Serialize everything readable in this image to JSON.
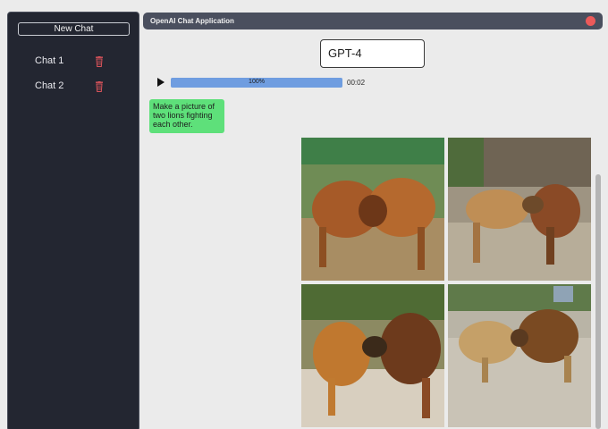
{
  "window": {
    "title": "OpenAI Chat Application"
  },
  "sidebar": {
    "new_chat_label": "New Chat",
    "chats": [
      {
        "label": "Chat 1"
      },
      {
        "label": "Chat 2"
      }
    ]
  },
  "model": {
    "selected": "GPT-4"
  },
  "audio": {
    "progress_label": "100%",
    "progress_fraction": 1.0,
    "elapsed": "00:02"
  },
  "message": {
    "text": "Make a picture of two lions fighting each other."
  },
  "images": [
    {
      "icon": "generated-image",
      "description": "lions-fighting-1"
    },
    {
      "icon": "generated-image",
      "description": "lions-fighting-2"
    },
    {
      "icon": "generated-image",
      "description": "lions-fighting-3"
    },
    {
      "icon": "generated-image",
      "description": "lions-fighting-4"
    }
  ],
  "colors": {
    "sidebar_bg": "#232631",
    "titlebar_bg": "#4a4f5e",
    "close_red": "#ec5a5a",
    "bubble_green": "#5ee07a",
    "progress_blue": "#6f9de0",
    "trash_red": "#d9535a"
  }
}
